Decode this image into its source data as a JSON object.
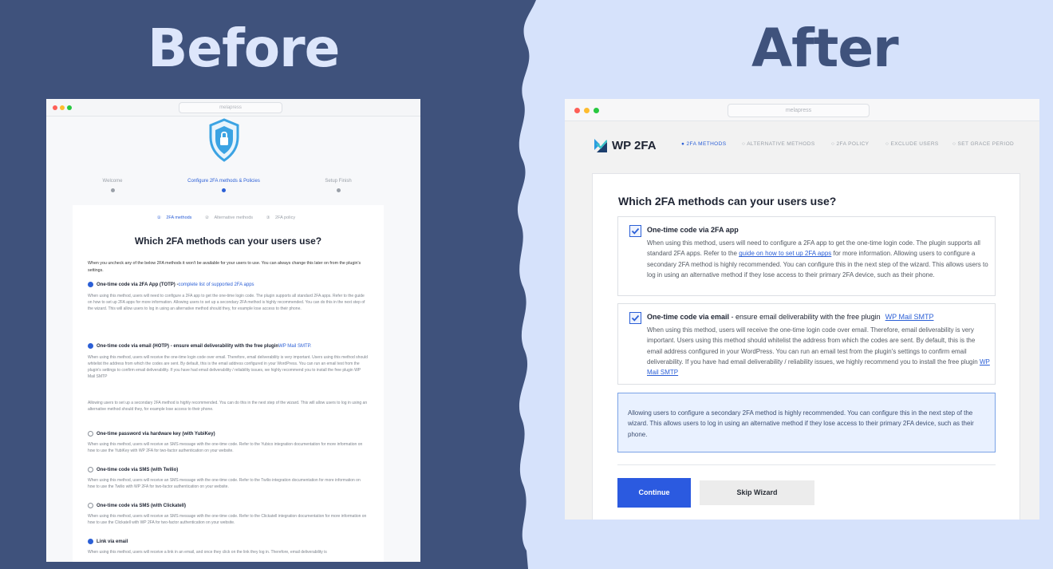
{
  "headings": {
    "before": "Before",
    "after": "After"
  },
  "colors": {
    "left_bg": "#3f527c",
    "right_bg": "#d6e2fb",
    "accent": "#2b5ae0"
  },
  "before": {
    "url": "melapress",
    "steps": [
      "Welcome",
      "Configure 2FA methods & Policies",
      "Setup Finish"
    ],
    "active_step": 1,
    "tabs": [
      "2FA methods",
      "Alternative methods",
      "2FA policy"
    ],
    "title": "Which 2FA methods can your users use?",
    "intro": "When you uncheck any of the below 2FA methods it won't be available for your users to use. You can always change this later on from the plugin's settings.",
    "opt1": {
      "label": "One-time code via 2FA App (TOTP) - ",
      "link": "complete list of supported 2FA apps",
      "checked": true
    },
    "opt1_desc": "When using this method, users will need to configure a 2FA app to get the one-time login code. The plugin supports all standard 2FA apps. Refer to the guide on how to set up 2FA apps for more information. Allowing users to set up a secondary 2FA method is highly recommended. You can do this in the next step of the wizard. This will allow users to log in using an alternative method should they, for example lose access to their phone.",
    "opt2": {
      "label": "One-time code via email (HOTP) - ensure email deliverability with the free plugin ",
      "link": "WP Mail SMTP.",
      "checked": true
    },
    "opt2_desc": "When using this method, users will receive the one-time login code over email. Therefore, email deliverability is very important. Users using this method should whitelist the address from which the codes are sent. By default, this is the email address configured in your WordPress. You can run an email test from the plugin's settings to confirm email deliverability. If you have had email deliverability / reliability issues, we highly recommend you to install the free plugin WP Mail SMTP",
    "secondary_note": "Allowing users to set up a secondary 2FA method is highly recommended. You can do this in the next step of the wizard. This will allow users to log in using an alternative method should they, for example lose access to their phone.",
    "opt3": {
      "label": "One-time password via hardware key (with YubiKey)"
    },
    "opt3_desc": "When using this method, users will receive an SMS message with the one-time code. Refer to the Yubico integration documentation for more information on how to use the YubiKey with WP 2FA for two-factor authentication on your website.",
    "opt4": {
      "label": "One-time code via SMS (with Twilio)"
    },
    "opt4_desc": "When using this method, users will receive an SMS message with the one-time code. Refer to the Twilio integration documentation for more information on how to use the Twilio with WP 2FA for two-factor authentication on your website.",
    "opt5": {
      "label": "One-time code via SMS (with Clickatell)"
    },
    "opt5_desc": "When using this method, users will receive an SMS message with the one-time code. Refer to the Clickatell integration documentation for more information on how to use the Clickatell with WP 2FA for two-factor authentication on your website.",
    "opt6": {
      "label": "Link via email",
      "checked": true
    },
    "opt6_desc": "When using this method, users will receive a link in an email, and once they click on the link they log in. Therefore, email deliverability is"
  },
  "after": {
    "url": "melapress",
    "logo": "WP 2FA",
    "nav": [
      "2FA METHODS",
      "ALTERNATIVE METHODS",
      "2FA POLICY",
      "EXCLUDE USERS",
      "SET GRACE PERIOD"
    ],
    "title": "Which 2FA methods can your users use?",
    "opt1": {
      "label": "One-time code via 2FA app",
      "checked": true,
      "desc_before": "When using this method, users will need to configure a 2FA app to get the one-time login code. The plugin supports all standard 2FA apps. Refer to the ",
      "desc_link": "guide on how to set up 2FA apps",
      "desc_after": " for more information. Allowing users to configure a secondary 2FA method is highly recommended. You can configure this in the next step of the wizard. This allows users to log in using an alternative method if they lose access to their primary 2FA device, such as their phone."
    },
    "opt2": {
      "label": "One-time code via email",
      "tail": " - ensure email deliverability with the free plugin",
      "link": "WP Mail SMTP",
      "checked": true,
      "desc": "When using this method, users will receive the one-time login code over email. Therefore, email deliverability is very important. Users using this method should whitelist the address from which the codes are sent. By default, this is the email address configured in your WordPress. You can run an email test from the plugin's settings to confirm email deliverability. If you have had email deliverability / reliability issues, we highly recommend you to install the free plugin ",
      "desc_link": "WP Mail SMTP"
    },
    "info": "Allowing users to configure a secondary 2FA method is highly recommended. You can configure this in the next step of the wizard. This allows users to log in using an alternative method if they lose access to their primary 2FA device, such as their phone.",
    "continue": "Continue",
    "skip": "Skip Wizard"
  }
}
